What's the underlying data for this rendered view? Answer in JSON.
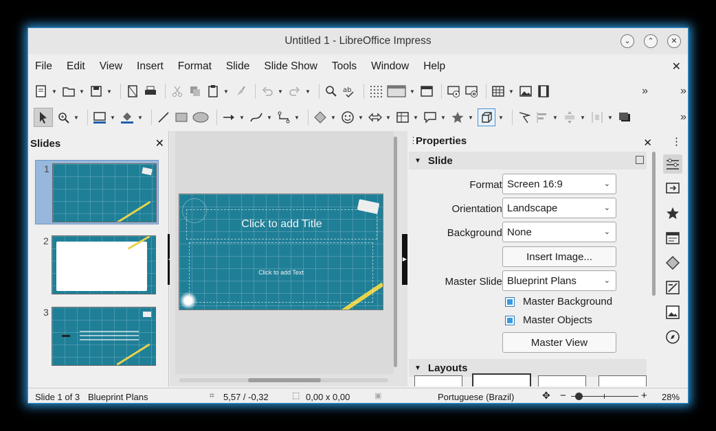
{
  "window": {
    "title": "Untitled 1 - LibreOffice Impress",
    "minimize_glyph": "⌄",
    "maximize_glyph": "⌃",
    "close_glyph": "✕"
  },
  "menu": [
    "File",
    "Edit",
    "View",
    "Insert",
    "Format",
    "Slide",
    "Slide Show",
    "Tools",
    "Window",
    "Help"
  ],
  "doc_close": "✕",
  "toolbar_overflow": "»",
  "slides_panel": {
    "title": "Slides",
    "close": "✕",
    "slides": [
      {
        "number": "1",
        "selected": true
      },
      {
        "number": "2",
        "selected": false
      },
      {
        "number": "3",
        "selected": false
      }
    ]
  },
  "slide": {
    "title_placeholder": "Click to add Title",
    "text_placeholder": "Click to add Text"
  },
  "properties": {
    "title": "Properties",
    "close": "✕",
    "more": "⋮",
    "slide_section": "Slide",
    "format_label": "Format:",
    "format_value": "Screen 16:9",
    "orientation_label": "Orientation:",
    "orientation_value": "Landscape",
    "background_label": "Background:",
    "background_value": "None",
    "insert_image": "Insert Image...",
    "master_slide_label": "Master Slide:",
    "master_slide_value": "Blueprint Plans",
    "master_background": "Master Background",
    "master_objects": "Master Objects",
    "master_view": "Master View",
    "layouts_section": "Layouts"
  },
  "status": {
    "slide_pos": "Slide 1 of 3",
    "master": "Blueprint Plans",
    "position": "5,57 / -0,32",
    "size": "0,00 x 0,00",
    "language": "Portuguese (Brazil)",
    "zoom_minus": "−",
    "zoom_plus": "+",
    "zoom": "28%"
  },
  "colors": {
    "accent": "#3a9be0",
    "blueprint": "#1f7f97",
    "window_glow": "#2b8fcf"
  }
}
